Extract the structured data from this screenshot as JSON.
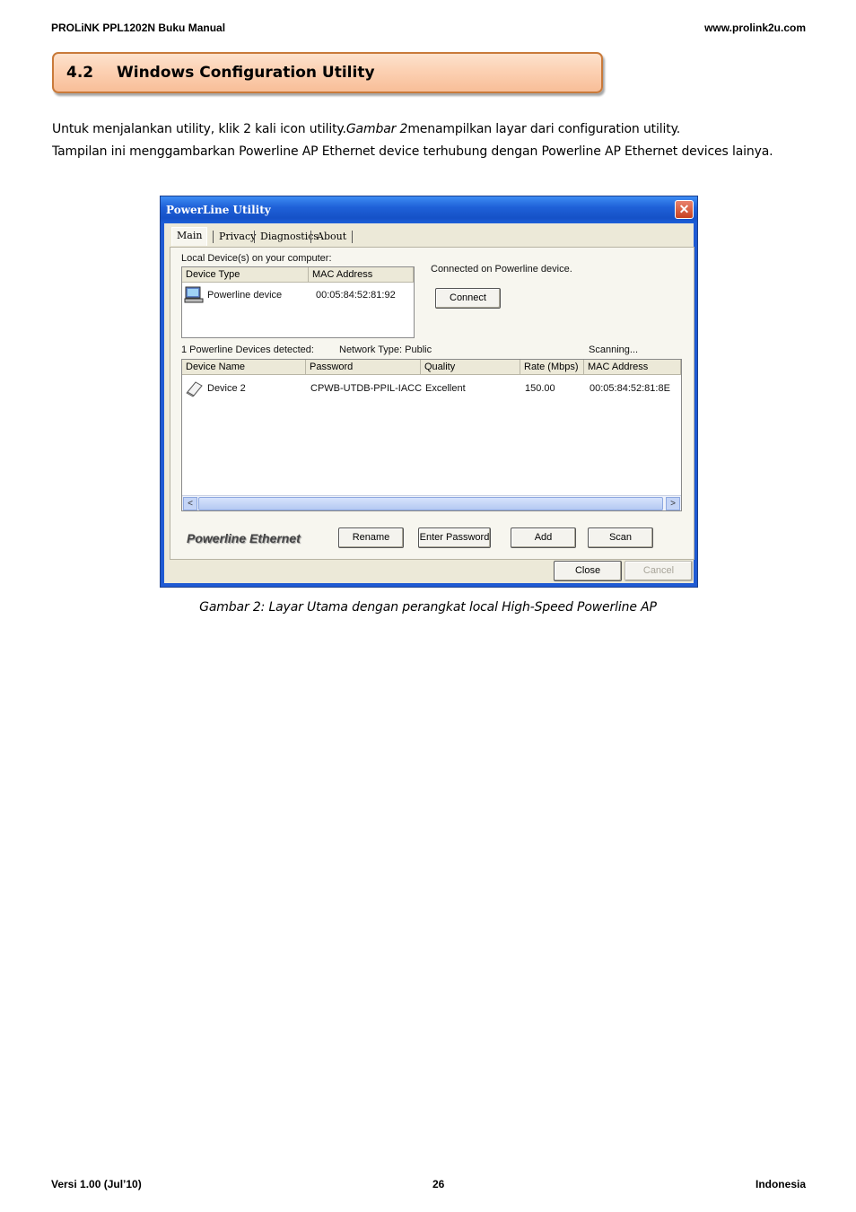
{
  "header": {
    "left": "PROLiNK PPL1202N Buku Manual",
    "right": "www.prolink2u.com"
  },
  "section": {
    "number": "4.2",
    "title": "Windows Configuration Utility"
  },
  "body": {
    "p1_before": "Untuk menjalankan utility, klik 2 kali icon utility.",
    "p1_italic": "Gambar 2",
    "p1_after": "menampilkan layar dari configuration utility.",
    "p2": "Tampilan ini menggambarkan Powerline AP Ethernet device terhubung dengan Powerline AP Ethernet devices lainya."
  },
  "dialog": {
    "title": "PowerLine Utility",
    "close_glyph": "✕",
    "tabs": [
      "Main",
      "Privacy",
      "Diagnostics",
      "About"
    ],
    "local_label": "Local Device(s) on your computer:",
    "local_columns": [
      "Device Type",
      "MAC Address"
    ],
    "local_rows": [
      {
        "device_type": "Powerline device",
        "mac": "00:05:84:52:81:92"
      }
    ],
    "connected_text": "Connected on Powerline device.",
    "connect_button": "Connect",
    "detected_text": "1 Powerline Devices detected:",
    "network_type": "Network Type: Public",
    "scanning": "Scanning...",
    "remote_columns": [
      "Device Name",
      "Password",
      "Quality",
      "Rate (Mbps)",
      "MAC Address"
    ],
    "remote_rows": [
      {
        "name": "Device 2",
        "password": "CPWB-UTDB-PPIL-IACC",
        "quality": "Excellent",
        "rate": "150.00",
        "mac": "00:05:84:52:81:8E"
      }
    ],
    "brand": "Powerline Ethernet",
    "buttons": {
      "rename": "Rename",
      "enter_password": "Enter Password",
      "add": "Add",
      "scan": "Scan",
      "close": "Close",
      "cancel": "Cancel"
    },
    "scroll_left": "<",
    "scroll_right": ">"
  },
  "caption": "Gambar 2: Layar Utama dengan perangkat local High-Speed Powerline AP",
  "footer": {
    "left": "Versi 1.00 (Jul’10)",
    "page": "26",
    "right": "Indonesia"
  }
}
